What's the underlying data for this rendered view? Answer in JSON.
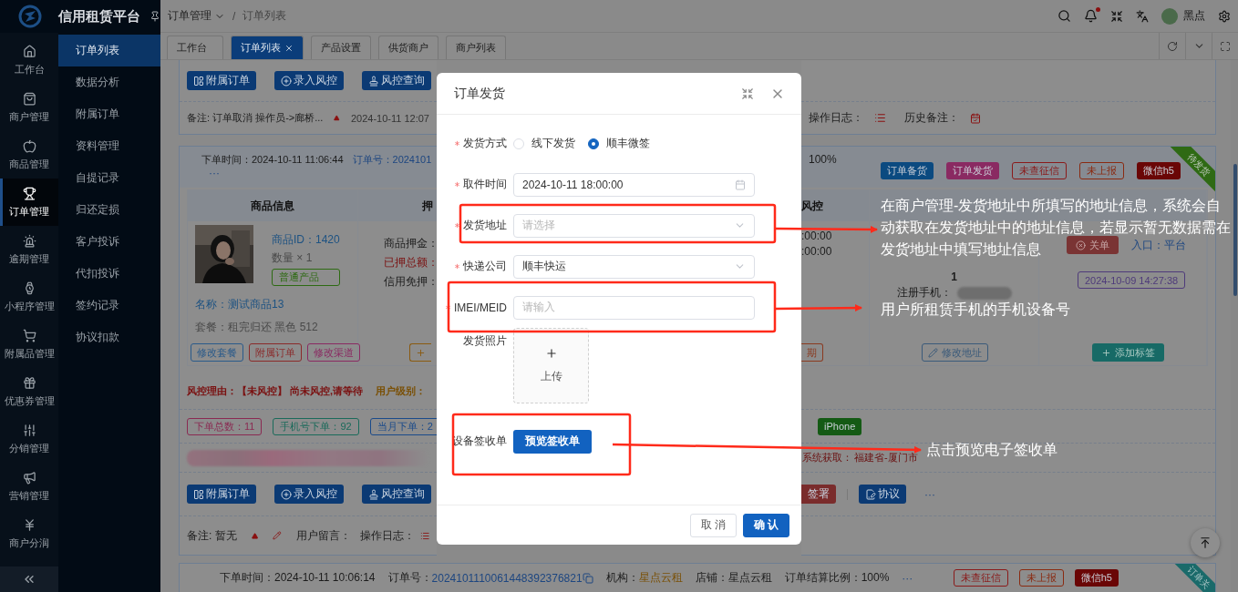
{
  "brand": {
    "title": "信用租赁平台"
  },
  "rail": [
    {
      "label": "工作台",
      "selected": false
    },
    {
      "label": "商户管理",
      "selected": false
    },
    {
      "label": "商品管理",
      "selected": false
    },
    {
      "label": "订单管理",
      "selected": true
    },
    {
      "label": "逾期管理",
      "selected": false
    },
    {
      "label": "小程序管理",
      "selected": false
    },
    {
      "label": "附属品管理",
      "selected": false
    },
    {
      "label": "优惠券管理",
      "selected": false
    },
    {
      "label": "分销管理",
      "selected": false
    },
    {
      "label": "营销管理",
      "selected": false
    },
    {
      "label": "商户分润",
      "selected": false
    }
  ],
  "submenu": [
    {
      "label": "订单列表",
      "selected": true
    },
    {
      "label": "数据分析",
      "selected": false
    },
    {
      "label": "附属订单",
      "selected": false
    },
    {
      "label": "资料管理",
      "selected": false
    },
    {
      "label": "自提记录",
      "selected": false
    },
    {
      "label": "归还定损",
      "selected": false
    },
    {
      "label": "客户投诉",
      "selected": false
    },
    {
      "label": "代扣投诉",
      "selected": false
    },
    {
      "label": "签约记录",
      "selected": false
    },
    {
      "label": "协议扣款",
      "selected": false
    }
  ],
  "breadcrumb": {
    "items": [
      "订单管理",
      "订单列表"
    ],
    "separator": "/"
  },
  "header": {
    "user": "黑点",
    "has_unread": true
  },
  "tabs": [
    {
      "label": "工作台",
      "selected": false,
      "closable": false
    },
    {
      "label": "订单列表",
      "selected": true,
      "closable": true
    },
    {
      "label": "产品设置",
      "selected": false,
      "closable": false
    },
    {
      "label": "供货商户",
      "selected": false,
      "closable": false
    },
    {
      "label": "商户列表",
      "selected": false,
      "closable": false
    }
  ],
  "order_above": {
    "actions": [
      "附属订单",
      "录入风控",
      "风控查询"
    ],
    "remark": "备注: 订单取消 操作员->廊桥...",
    "remark_time": "2024-10-11 12:07",
    "log_label": "操作日志：",
    "history_label": "历史备注："
  },
  "order_current": {
    "time": "下单时间：2024-10-11 11:06:44",
    "order_no": "订单号：2024101",
    "more": "···",
    "ratio": "100%",
    "tags": [
      {
        "label": "订单备货",
        "kind": "filled",
        "color": "#0b4a80"
      },
      {
        "label": "订单发货",
        "kind": "filled",
        "color": "#8a2a62"
      },
      {
        "label": "未查征信",
        "kind": "outline",
        "color": "#8a1a1a"
      },
      {
        "label": "未上报",
        "kind": "outline",
        "color": "#8a2a10"
      },
      {
        "label": "微信h5",
        "kind": "filled",
        "color": "#6a0606"
      }
    ],
    "ribbon": {
      "label": "待发货",
      "color": "#2f6a14"
    },
    "product": {
      "header": "商品信息",
      "id": "商品ID：1420",
      "qty": "数量 × 1",
      "type_tag": "普通产品",
      "name": "名称：测试商品13",
      "package": "套餐：租完归还 黑色 512",
      "actions": [
        {
          "label": "修改套餐",
          "color": "#2a5a8a"
        },
        {
          "label": "附属订单",
          "color": "#8a2a2a"
        },
        {
          "label": "修改渠道",
          "color": "#8a2a62"
        }
      ]
    },
    "deposit": {
      "header": "押",
      "lines": [
        {
          "text": "商品押金：",
          "kind": "normal"
        },
        {
          "text": "已押总额：",
          "kind": "alert"
        },
        {
          "text": "信用免押：",
          "kind": "normal"
        }
      ]
    },
    "risk": {
      "header": "风控",
      "times": [
        ":00:00",
        ":00:00"
      ],
      "action": "期"
    },
    "address": {
      "line": "1",
      "phone_label": "注册手机：",
      "action": "修改地址"
    },
    "status": {
      "close_button": "关单",
      "entry_label": "入口：",
      "entry_value": "平台",
      "time_tag": "2024-10-09 14:27:38",
      "action": "添加标签"
    },
    "risk_reason": "风控理由：【未风控】 尚未风控,请等待",
    "user_level": "用户级别：",
    "counts": [
      {
        "text": "下单总数：11",
        "color": "#8a2a52"
      },
      {
        "text": "手机号下单：92",
        "color": "#1a6a5a"
      },
      {
        "text": "当月下单：2",
        "color": "#1a4a8a"
      }
    ],
    "device_tag": "iPhone",
    "system_label": "系统获取：",
    "system_value": "福建省-厦门市",
    "actions": [
      "附属订单",
      "录入风控",
      "风控查询"
    ],
    "actions_right": [
      {
        "label": "签署",
        "kind": "danger"
      },
      {
        "label": "协议",
        "kind": "primary"
      }
    ],
    "more_right": "···",
    "remark": "备注: 暂无",
    "message_label": "用户留言：",
    "log_label": "操作日志："
  },
  "order_next": {
    "time": "下单时间：2024-10-11 10:06:14",
    "order_no_label": "订单号：",
    "order_no": "2024101110061448392376821",
    "org_label": "机构：",
    "org": "星点云租",
    "shop": "店铺：星点云租",
    "ratio": "订单结算比例：100%",
    "more": "···",
    "tags": [
      {
        "label": "未查征信",
        "kind": "outline",
        "color": "#8a1a1a"
      },
      {
        "label": "未上报",
        "kind": "outline",
        "color": "#8a2a10"
      },
      {
        "label": "微信h5",
        "kind": "filled",
        "color": "#6a0606"
      }
    ],
    "ribbon": {
      "label": "订单关",
      "color": "#1a6a6a"
    }
  },
  "dialog": {
    "title": "订单发货",
    "fields": [
      {
        "kind": "radio",
        "label": "发货方式",
        "required": true,
        "options": [
          {
            "label": "线下发货",
            "selected": false
          },
          {
            "label": "顺丰微签",
            "selected": true
          }
        ]
      },
      {
        "kind": "date",
        "label": "取件时间",
        "required": true,
        "value": "2024-10-11 18:00:00"
      },
      {
        "kind": "select",
        "label": "发货地址",
        "required": true,
        "placeholder": "请选择"
      },
      {
        "kind": "select",
        "label": "快递公司",
        "required": true,
        "value": "顺丰快运"
      },
      {
        "kind": "input",
        "label": "IMEI/MEID",
        "required": true,
        "placeholder": "请输入"
      },
      {
        "kind": "upload",
        "label": "发货照片",
        "required": false,
        "button": "上传"
      },
      {
        "kind": "button",
        "label": "设备签收单",
        "required": false,
        "button": "预览签收单"
      }
    ],
    "cancel": "取 消",
    "confirm": "确 认"
  },
  "annotations": [
    {
      "lines": [
        "在商户管理-发货地址中所填写的地址信息，系统会自",
        "动获取在发货地址中的地址信息，若显示暂无数据需在",
        "发货地址中填写地址信息"
      ]
    },
    {
      "lines": [
        "用户所租赁手机的手机设备号"
      ]
    },
    {
      "lines": [
        "点击预览电子签收单"
      ]
    }
  ]
}
